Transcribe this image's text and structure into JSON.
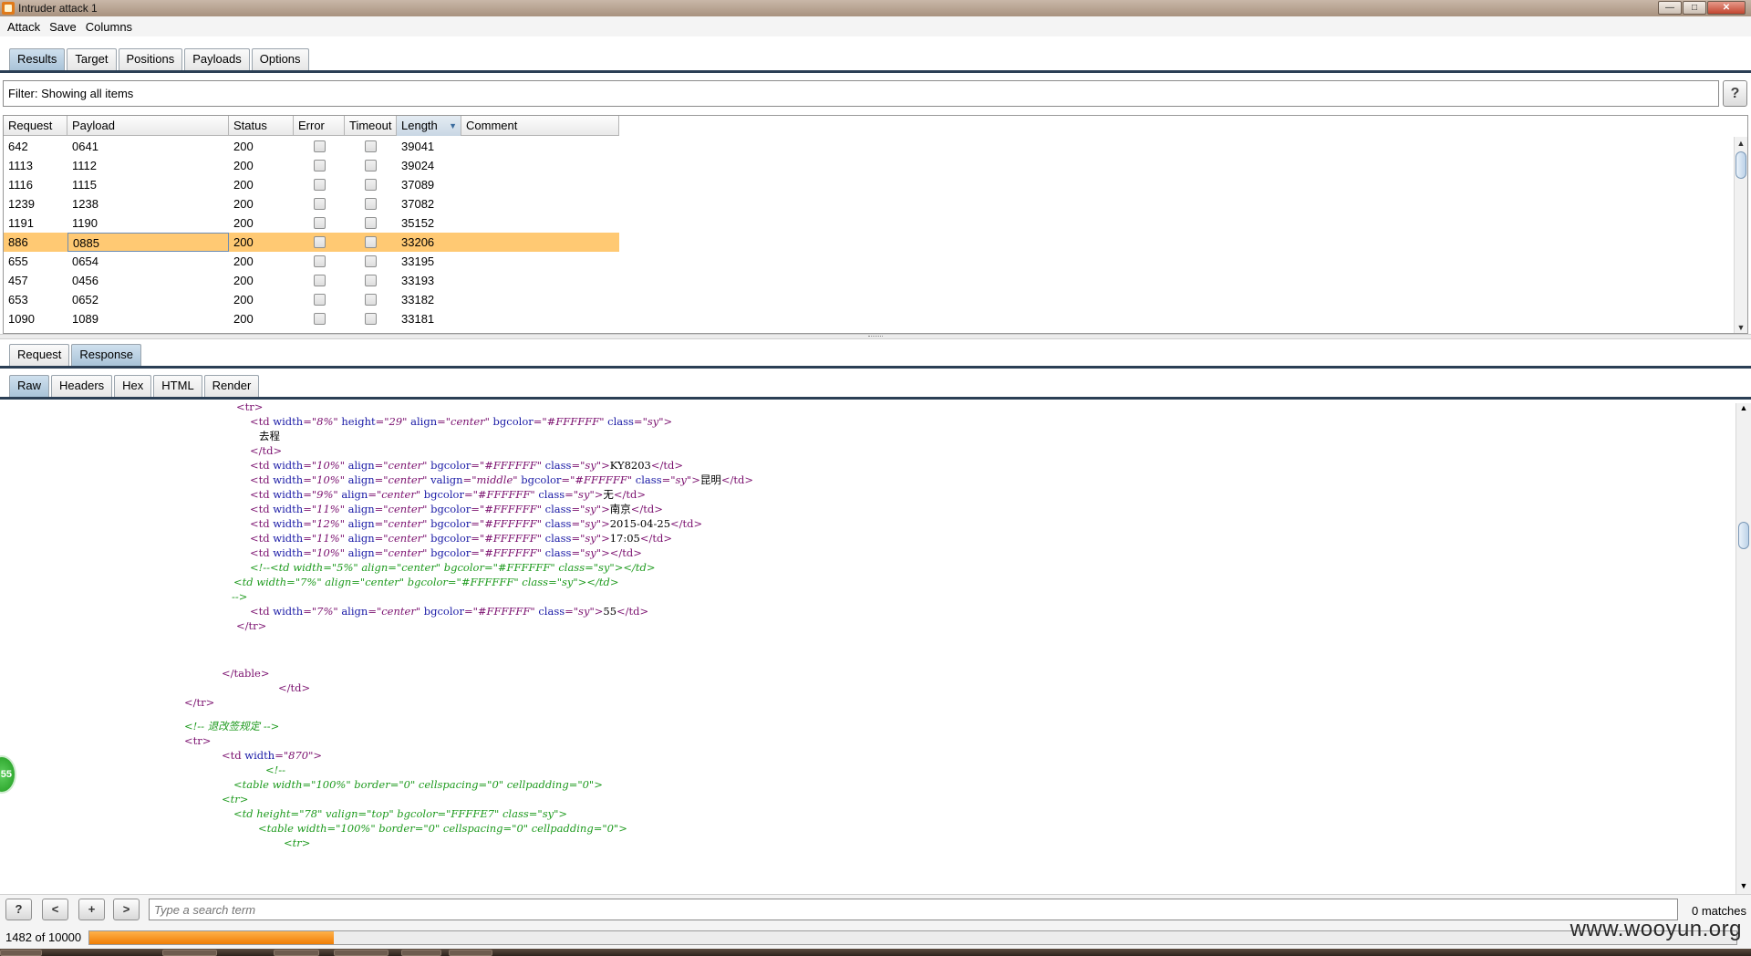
{
  "window": {
    "title": "Intruder attack 1",
    "buttons": {
      "minimize": "—",
      "maximize": "□",
      "close": "✕"
    }
  },
  "menu": [
    "Attack",
    "Save",
    "Columns"
  ],
  "main_tabs": [
    "Results",
    "Target",
    "Positions",
    "Payloads",
    "Options"
  ],
  "filter": {
    "label": "Filter:",
    "value": "Showing all items",
    "help": "?"
  },
  "results": {
    "columns": [
      "Request",
      "Payload",
      "Status",
      "Error",
      "Timeout",
      "Length",
      "Comment"
    ],
    "sorted_column": "Length",
    "rows": [
      {
        "request": "642",
        "payload": "0641",
        "status": "200",
        "length": "39041",
        "selected": false
      },
      {
        "request": "1113",
        "payload": "1112",
        "status": "200",
        "length": "39024",
        "selected": false
      },
      {
        "request": "1116",
        "payload": "1115",
        "status": "200",
        "length": "37089",
        "selected": false
      },
      {
        "request": "1239",
        "payload": "1238",
        "status": "200",
        "length": "37082",
        "selected": false
      },
      {
        "request": "1191",
        "payload": "1190",
        "status": "200",
        "length": "35152",
        "selected": false
      },
      {
        "request": "886",
        "payload": "0885",
        "status": "200",
        "length": "33206",
        "selected": true
      },
      {
        "request": "655",
        "payload": "0654",
        "status": "200",
        "length": "33195",
        "selected": false
      },
      {
        "request": "457",
        "payload": "0456",
        "status": "200",
        "length": "33193",
        "selected": false
      },
      {
        "request": "653",
        "payload": "0652",
        "status": "200",
        "length": "33182",
        "selected": false
      },
      {
        "request": "1090",
        "payload": "1089",
        "status": "200",
        "length": "33181",
        "selected": false
      }
    ]
  },
  "message_tabs": [
    "Request",
    "Response"
  ],
  "view_tabs": [
    "Raw",
    "Headers",
    "Hex",
    "HTML",
    "Render"
  ],
  "code_lines": [
    [
      {
        "t": "tag",
        "s": "<tr>"
      }
    ],
    [
      {
        "t": "tag",
        "s": "<td "
      },
      {
        "t": "attr",
        "s": "width"
      },
      {
        "t": "tag",
        "s": "="
      },
      {
        "t": "val",
        "s": "\"8%\""
      },
      {
        "t": "attr",
        "s": " height"
      },
      {
        "t": "tag",
        "s": "="
      },
      {
        "t": "val",
        "s": "\"29\""
      },
      {
        "t": "attr",
        "s": " align"
      },
      {
        "t": "tag",
        "s": "="
      },
      {
        "t": "val",
        "s": "\"center\""
      },
      {
        "t": "attr",
        "s": " bgcolor"
      },
      {
        "t": "tag",
        "s": "="
      },
      {
        "t": "val",
        "s": "\"#FFFFFF\""
      },
      {
        "t": "attr",
        "s": " class"
      },
      {
        "t": "tag",
        "s": "="
      },
      {
        "t": "val",
        "s": "\"sy\""
      },
      {
        "t": "tag",
        "s": ">"
      }
    ],
    [
      {
        "t": "txt",
        "s": "去程"
      }
    ],
    [
      {
        "t": "tag",
        "s": "</td>"
      }
    ],
    [
      {
        "t": "tag",
        "s": "<td "
      },
      {
        "t": "attr",
        "s": "width"
      },
      {
        "t": "tag",
        "s": "="
      },
      {
        "t": "val",
        "s": "\"10%\""
      },
      {
        "t": "attr",
        "s": " align"
      },
      {
        "t": "tag",
        "s": "="
      },
      {
        "t": "val",
        "s": "\"center\""
      },
      {
        "t": "attr",
        "s": " bgcolor"
      },
      {
        "t": "tag",
        "s": "="
      },
      {
        "t": "val",
        "s": "\"#FFFFFF\""
      },
      {
        "t": "attr",
        "s": " class"
      },
      {
        "t": "tag",
        "s": "="
      },
      {
        "t": "val",
        "s": "\"sy\""
      },
      {
        "t": "tag",
        "s": ">"
      },
      {
        "t": "txt",
        "s": "KY8203"
      },
      {
        "t": "tag",
        "s": "</td>"
      }
    ],
    [
      {
        "t": "tag",
        "s": "<td "
      },
      {
        "t": "attr",
        "s": "width"
      },
      {
        "t": "tag",
        "s": "="
      },
      {
        "t": "val",
        "s": "\"10%\""
      },
      {
        "t": "attr",
        "s": " align"
      },
      {
        "t": "tag",
        "s": "="
      },
      {
        "t": "val",
        "s": "\"center\""
      },
      {
        "t": "attr",
        "s": " valign"
      },
      {
        "t": "tag",
        "s": "="
      },
      {
        "t": "val",
        "s": "\"middle\""
      },
      {
        "t": "attr",
        "s": " bgcolor"
      },
      {
        "t": "tag",
        "s": "="
      },
      {
        "t": "val",
        "s": "\"#FFFFFF\""
      },
      {
        "t": "attr",
        "s": " class"
      },
      {
        "t": "tag",
        "s": "="
      },
      {
        "t": "val",
        "s": "\"sy\""
      },
      {
        "t": "tag",
        "s": ">"
      },
      {
        "t": "txt",
        "s": "昆明"
      },
      {
        "t": "tag",
        "s": "</td>"
      }
    ],
    [
      {
        "t": "tag",
        "s": "<td "
      },
      {
        "t": "attr",
        "s": "width"
      },
      {
        "t": "tag",
        "s": "="
      },
      {
        "t": "val",
        "s": "\"9%\""
      },
      {
        "t": "attr",
        "s": " align"
      },
      {
        "t": "tag",
        "s": "="
      },
      {
        "t": "val",
        "s": "\"center\""
      },
      {
        "t": "attr",
        "s": " bgcolor"
      },
      {
        "t": "tag",
        "s": "="
      },
      {
        "t": "val",
        "s": "\"#FFFFFF\""
      },
      {
        "t": "attr",
        "s": " class"
      },
      {
        "t": "tag",
        "s": "="
      },
      {
        "t": "val",
        "s": "\"sy\""
      },
      {
        "t": "tag",
        "s": ">"
      },
      {
        "t": "txt",
        "s": "无"
      },
      {
        "t": "tag",
        "s": "</td>"
      }
    ],
    [
      {
        "t": "tag",
        "s": "<td "
      },
      {
        "t": "attr",
        "s": "width"
      },
      {
        "t": "tag",
        "s": "="
      },
      {
        "t": "val",
        "s": "\"11%\""
      },
      {
        "t": "attr",
        "s": " align"
      },
      {
        "t": "tag",
        "s": "="
      },
      {
        "t": "val",
        "s": "\"center\""
      },
      {
        "t": "attr",
        "s": " bgcolor"
      },
      {
        "t": "tag",
        "s": "="
      },
      {
        "t": "val",
        "s": "\"#FFFFFF\""
      },
      {
        "t": "attr",
        "s": " class"
      },
      {
        "t": "tag",
        "s": "="
      },
      {
        "t": "val",
        "s": "\"sy\""
      },
      {
        "t": "tag",
        "s": ">"
      },
      {
        "t": "txt",
        "s": "南京"
      },
      {
        "t": "tag",
        "s": "</td>"
      }
    ],
    [
      {
        "t": "tag",
        "s": "<td "
      },
      {
        "t": "attr",
        "s": "width"
      },
      {
        "t": "tag",
        "s": "="
      },
      {
        "t": "val",
        "s": "\"12%\""
      },
      {
        "t": "attr",
        "s": " align"
      },
      {
        "t": "tag",
        "s": "="
      },
      {
        "t": "val",
        "s": "\"center\""
      },
      {
        "t": "attr",
        "s": " bgcolor"
      },
      {
        "t": "tag",
        "s": "="
      },
      {
        "t": "val",
        "s": "\"#FFFFFF\""
      },
      {
        "t": "attr",
        "s": " class"
      },
      {
        "t": "tag",
        "s": "="
      },
      {
        "t": "val",
        "s": "\"sy\""
      },
      {
        "t": "tag",
        "s": ">"
      },
      {
        "t": "txt",
        "s": "2015-04-25"
      },
      {
        "t": "tag",
        "s": "</td>"
      }
    ],
    [
      {
        "t": "tag",
        "s": "<td "
      },
      {
        "t": "attr",
        "s": "width"
      },
      {
        "t": "tag",
        "s": "="
      },
      {
        "t": "val",
        "s": "\"11%\""
      },
      {
        "t": "attr",
        "s": " align"
      },
      {
        "t": "tag",
        "s": "="
      },
      {
        "t": "val",
        "s": "\"center\""
      },
      {
        "t": "attr",
        "s": " bgcolor"
      },
      {
        "t": "tag",
        "s": "="
      },
      {
        "t": "val",
        "s": "\"#FFFFFF\""
      },
      {
        "t": "attr",
        "s": " class"
      },
      {
        "t": "tag",
        "s": "="
      },
      {
        "t": "val",
        "s": "\"sy\""
      },
      {
        "t": "tag",
        "s": ">"
      },
      {
        "t": "txt",
        "s": "17:05"
      },
      {
        "t": "tag",
        "s": "</td>"
      }
    ],
    [
      {
        "t": "tag",
        "s": "<td "
      },
      {
        "t": "attr",
        "s": "width"
      },
      {
        "t": "tag",
        "s": "="
      },
      {
        "t": "val",
        "s": "\"10%\""
      },
      {
        "t": "attr",
        "s": " align"
      },
      {
        "t": "tag",
        "s": "="
      },
      {
        "t": "val",
        "s": "\"center\""
      },
      {
        "t": "attr",
        "s": " bgcolor"
      },
      {
        "t": "tag",
        "s": "="
      },
      {
        "t": "val",
        "s": "\"#FFFFFF\""
      },
      {
        "t": "attr",
        "s": " class"
      },
      {
        "t": "tag",
        "s": "="
      },
      {
        "t": "val",
        "s": "\"sy\""
      },
      {
        "t": "tag",
        "s": "></td>"
      }
    ],
    [
      {
        "t": "cmt",
        "s": "<!--<td width=\"5%\" align=\"center\" bgcolor=\"#FFFFFF\" class=\"sy\"></td>"
      }
    ],
    [
      {
        "t": "cmt",
        "s": "<td width=\"7%\" align=\"center\" bgcolor=\"#FFFFFF\" class=\"sy\"></td>"
      }
    ],
    [
      {
        "t": "cmt",
        "s": "-->"
      }
    ],
    [
      {
        "t": "tag",
        "s": "<td "
      },
      {
        "t": "attr",
        "s": "width"
      },
      {
        "t": "tag",
        "s": "="
      },
      {
        "t": "val",
        "s": "\"7%\""
      },
      {
        "t": "attr",
        "s": " align"
      },
      {
        "t": "tag",
        "s": "="
      },
      {
        "t": "val",
        "s": "\"center\""
      },
      {
        "t": "attr",
        "s": " bgcolor"
      },
      {
        "t": "tag",
        "s": "="
      },
      {
        "t": "val",
        "s": "\"#FFFFFF\""
      },
      {
        "t": "attr",
        "s": " class"
      },
      {
        "t": "tag",
        "s": "="
      },
      {
        "t": "val",
        "s": "\"sy\""
      },
      {
        "t": "tag",
        "s": ">"
      },
      {
        "t": "txt",
        "s": "55"
      },
      {
        "t": "tag",
        "s": "</td>"
      }
    ],
    [
      {
        "t": "tag",
        "s": "</tr>"
      }
    ],
    [
      {
        "t": "tag",
        "s": "</table>"
      }
    ],
    [
      {
        "t": "tag",
        "s": "</td>"
      }
    ],
    [
      {
        "t": "tag",
        "s": "</tr>"
      }
    ],
    [
      {
        "t": "cmt",
        "s": "<!-- 退改签规定 -->"
      }
    ],
    [
      {
        "t": "tag",
        "s": "<tr>"
      }
    ],
    [
      {
        "t": "tag",
        "s": "<td "
      },
      {
        "t": "attr",
        "s": "width"
      },
      {
        "t": "tag",
        "s": "="
      },
      {
        "t": "val",
        "s": "\"870\""
      },
      {
        "t": "tag",
        "s": ">"
      }
    ],
    [
      {
        "t": "cmt",
        "s": "<!--"
      }
    ],
    [
      {
        "t": "cmt",
        "s": "<table width=\"100%\" border=\"0\" cellspacing=\"0\" cellpadding=\"0\">"
      }
    ],
    [
      {
        "t": "cmt",
        "s": "<tr>"
      }
    ],
    [
      {
        "t": "cmt",
        "s": "<td height=\"78\" valign=\"top\" bgcolor=\"FFFFE7\" class=\"sy\">"
      }
    ],
    [
      {
        "t": "cmt",
        "s": "<table width=\"100%\" border=\"0\" cellspacing=\"0\" cellpadding=\"0\">"
      }
    ],
    [
      {
        "t": "cmt",
        "s": "<tr>"
      }
    ]
  ],
  "search": {
    "placeholder": "Type a search term",
    "matches": "0 matches",
    "help": "?",
    "prev": "<",
    "add": "+",
    "next": ">"
  },
  "status": {
    "count": "1482 of 10000",
    "progress": 0.1482
  },
  "bubble_text": "55",
  "watermark": "www.wooyun.org"
}
